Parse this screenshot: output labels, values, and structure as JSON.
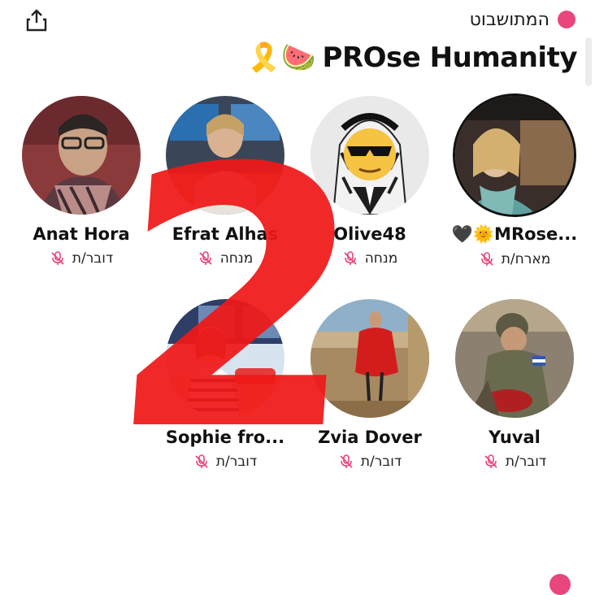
{
  "header": {
    "status_label": "המתושבוט",
    "title_emoji": "🎗️🍉",
    "room_title": "PROse Humanity"
  },
  "participants": [
    {
      "name": "Anat Hora",
      "role": "דובר/ת",
      "avatar": "woman-glasses-scarf"
    },
    {
      "name": "Efrat Alhas",
      "role": "מנחה",
      "avatar": "woman-desk-monitors"
    },
    {
      "name": "Olive48",
      "role": "מנחה",
      "avatar": "keffiyeh-sunglasses-emoji"
    },
    {
      "name": "🖤🌞MRose...",
      "role": "מארח/ת",
      "avatar": "woman-green-scarf"
    },
    {
      "name": "Sophie fro...",
      "role": "דובר/ת",
      "avatar": "woman-on-phone"
    },
    {
      "name": "Zvia Dover",
      "role": "דובר/ת",
      "avatar": "woman-red-dress"
    },
    {
      "name": "Yuval",
      "role": "דובר/ת",
      "avatar": "soldier-with-child"
    }
  ],
  "overlay_number": "2",
  "colors": {
    "accent": "#e8467c",
    "overlay": "#f01818"
  }
}
